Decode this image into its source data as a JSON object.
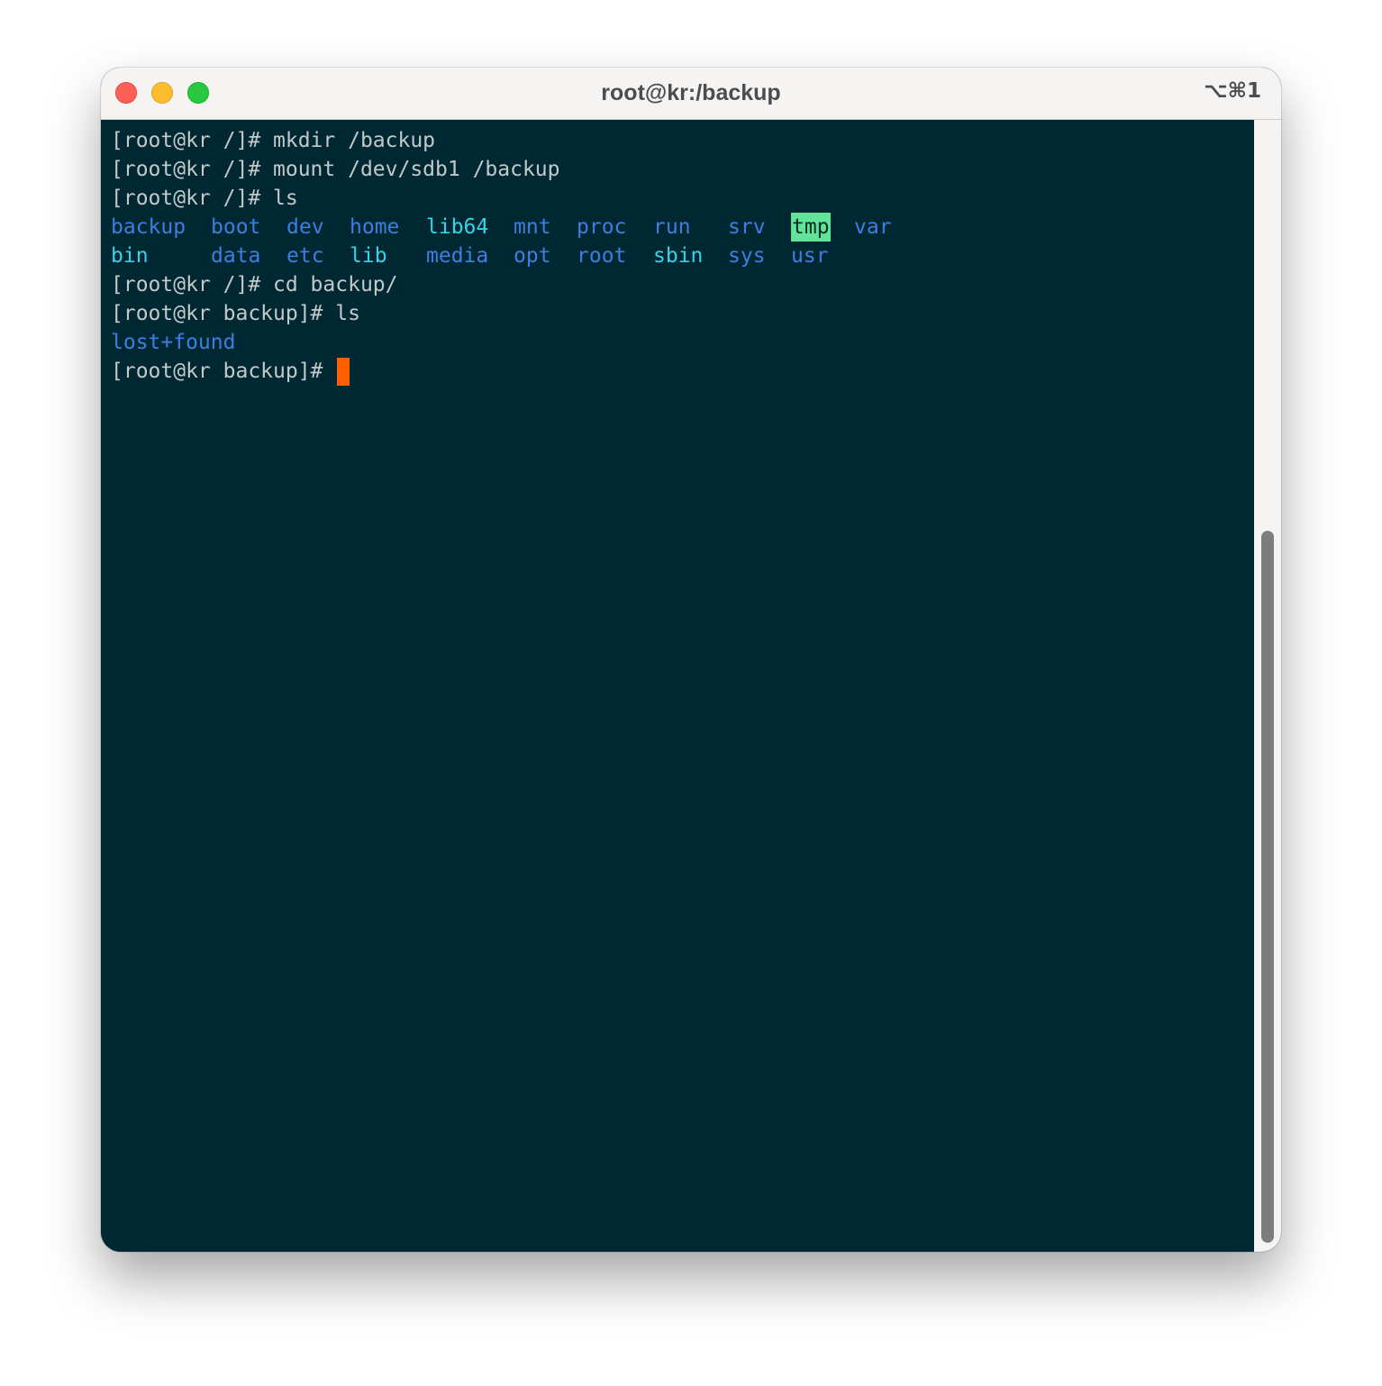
{
  "window": {
    "title": "root@kr:/backup",
    "shortcut": "⌥⌘1"
  },
  "terminal": {
    "lines": [
      "[root@kr /]# mkdir /backup",
      "[root@kr /]# mount /dev/sdb1 /backup",
      "[root@kr /]# ls",
      "[root@kr /]# cd backup/",
      "[root@kr backup]# ls",
      "[root@kr backup]# "
    ],
    "ls_root": {
      "row1": [
        "backup",
        "boot",
        "dev",
        "home",
        "lib64",
        "mnt",
        "proc",
        "run",
        "srv",
        "tmp",
        "var"
      ],
      "row2": [
        "bin",
        "data",
        "etc",
        "lib",
        "media",
        "opt",
        "root",
        "sbin",
        "sys",
        "usr"
      ]
    },
    "ls_backup": [
      "lost+found"
    ]
  },
  "colors": {
    "background": "#002833",
    "text": "#c3c8cb",
    "directory": "#3d7fe0",
    "symlink": "#35d3e6",
    "sticky_bg": "#5fe49a",
    "cursor": "#ff5f00"
  }
}
